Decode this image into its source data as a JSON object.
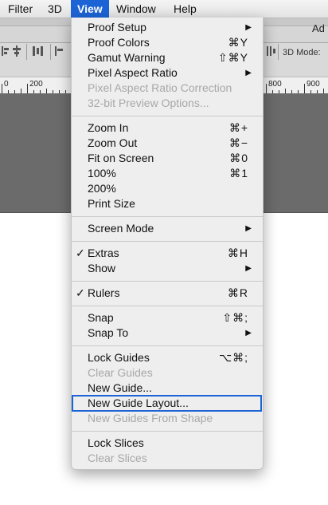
{
  "menubar": {
    "items": [
      {
        "label": "Filter"
      },
      {
        "label": "3D"
      },
      {
        "label": "View"
      },
      {
        "label": "Window"
      },
      {
        "label": "Help"
      }
    ]
  },
  "optbar": {
    "right_title": "Ad",
    "mode_label": "3D Mode:"
  },
  "ruler": {
    "labels": [
      "0",
      "200",
      "800",
      "900"
    ]
  },
  "view_menu": {
    "items": [
      {
        "label": "Proof Setup",
        "shortcut": "",
        "submenu": true
      },
      {
        "label": "Proof Colors",
        "shortcut": "⌘Y"
      },
      {
        "label": "Gamut Warning",
        "shortcut": "⇧⌘Y"
      },
      {
        "label": "Pixel Aspect Ratio",
        "shortcut": "",
        "submenu": true
      },
      {
        "label": "Pixel Aspect Ratio Correction",
        "disabled": true
      },
      {
        "label": "32-bit Preview Options...",
        "disabled": true
      },
      {
        "label": "Zoom In",
        "shortcut": "⌘+"
      },
      {
        "label": "Zoom Out",
        "shortcut": "⌘−"
      },
      {
        "label": "Fit on Screen",
        "shortcut": "⌘0"
      },
      {
        "label": "100%",
        "shortcut": "⌘1"
      },
      {
        "label": "200%",
        "shortcut": ""
      },
      {
        "label": "Print Size",
        "shortcut": ""
      },
      {
        "label": "Screen Mode",
        "submenu": true
      },
      {
        "label": "Extras",
        "shortcut": "⌘H",
        "checked": true
      },
      {
        "label": "Show",
        "submenu": true
      },
      {
        "label": "Rulers",
        "shortcut": "⌘R",
        "checked": true
      },
      {
        "label": "Snap",
        "shortcut": "⇧⌘;"
      },
      {
        "label": "Snap To",
        "submenu": true
      },
      {
        "label": "Lock Guides",
        "shortcut": "⌥⌘;"
      },
      {
        "label": "Clear Guides",
        "disabled": true
      },
      {
        "label": "New Guide..."
      },
      {
        "label": "New Guide Layout...",
        "highlighted": true
      },
      {
        "label": "New Guides From Shape",
        "disabled": true
      },
      {
        "label": "Lock Slices"
      },
      {
        "label": "Clear Slices",
        "disabled": true
      }
    ],
    "check_glyph": "✓",
    "arrow_glyph": "▶"
  },
  "colors": {
    "accent": "#1c64d5",
    "menu_bg": "#eeeeee",
    "disabled_text": "#a8a8a8",
    "canvas_gray": "#6b6b6b"
  }
}
